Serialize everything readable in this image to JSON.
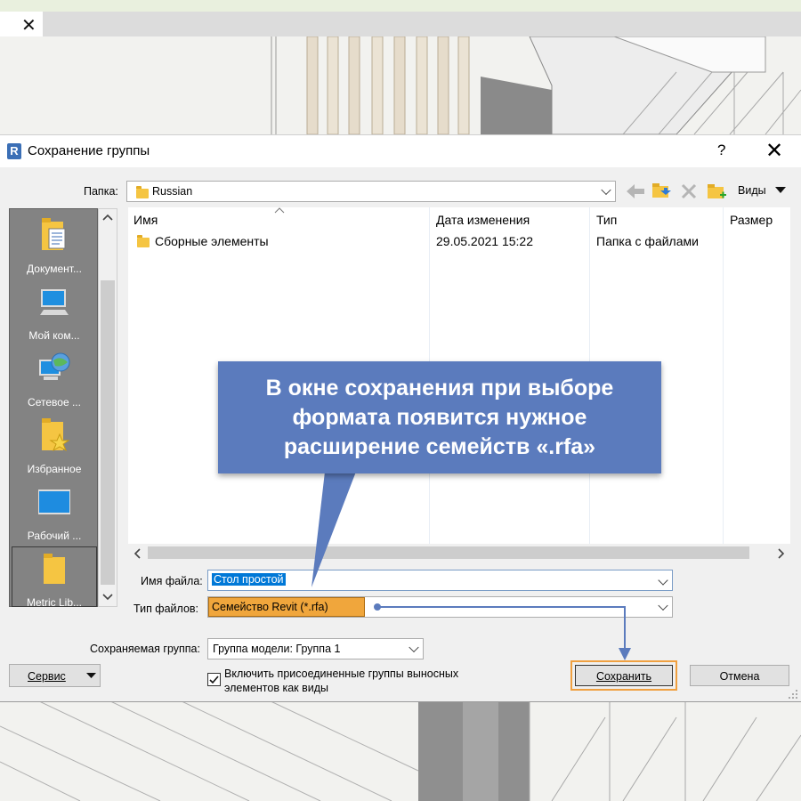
{
  "background": {
    "tab_close_glyph": "✕"
  },
  "dialog": {
    "app_icon_letter": "R",
    "title": "Сохранение группы",
    "help_glyph": "?",
    "close_glyph": "✕",
    "folder_label": "Папка:",
    "folder_value": "Russian",
    "views_label": "Виды",
    "places": [
      {
        "label": "Документ...",
        "icon": "documents-icon"
      },
      {
        "label": "Мой ком...",
        "icon": "my-computer-icon"
      },
      {
        "label": "Сетевое ...",
        "icon": "network-icon"
      },
      {
        "label": "Избранное",
        "icon": "favorites-icon"
      },
      {
        "label": "Рабочий ...",
        "icon": "desktop-icon"
      },
      {
        "label": "Metric Lib...",
        "icon": "metric-library-icon"
      }
    ],
    "columns": [
      "Имя",
      "Дата изменения",
      "Тип",
      "Размер"
    ],
    "rows": [
      {
        "name": "Сборные элементы",
        "date": "29.05.2021 15:22",
        "type": "Папка с файлами",
        "size": ""
      }
    ],
    "filename_label": "Имя файла:",
    "filename_value": "Стол простой",
    "filetype_label": "Тип файлов:",
    "filetype_value": "Семейство Revit  (*.rfa)",
    "group_label": "Сохраняемая группа:",
    "group_value": "Группа модели: Группа 1",
    "service_button": "Сервис",
    "checkbox_label_line1": "Включить присоединенные группы выносных",
    "checkbox_label_line2": "элементов как виды",
    "checkbox_checked": true,
    "save_button": "Сохранить",
    "cancel_button": "Отмена"
  },
  "callout": {
    "line1": "В окне сохранения при выборе",
    "line2": "формата появится нужное",
    "line3": "расширение семейств «.rfa»"
  },
  "colors": {
    "callout_bg": "#5b7bbd",
    "highlight_orange": "#f0a040",
    "filetype_highlight": "#f0a63c",
    "selection_blue": "#0078d7",
    "places_bg": "#838383"
  }
}
